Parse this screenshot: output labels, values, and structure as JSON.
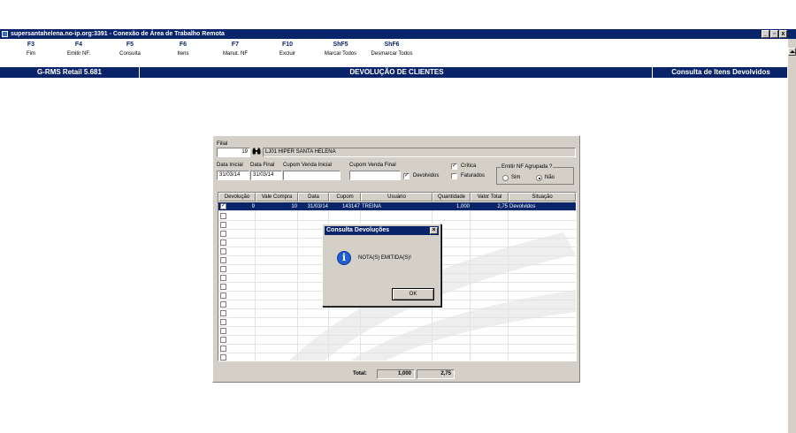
{
  "window": {
    "title": "supersantahelena.no-ip.org:3391 - Conexão de Área de Trabalho Remota",
    "min_glyph": "_",
    "max_glyph": "▫",
    "close_glyph": "x"
  },
  "function_keys": [
    {
      "key": "F3",
      "label": "Fim"
    },
    {
      "key": "F4",
      "label": "Emitir NF."
    },
    {
      "key": "F5",
      "label": "Consulta"
    },
    {
      "key": "F6",
      "label": "Itens"
    },
    {
      "key": "F7",
      "label": "Manut. NF"
    },
    {
      "key": "F10",
      "label": "Excluir"
    },
    {
      "key": "ShF5",
      "label": "Marcar Todos"
    },
    {
      "key": "ShF6",
      "label": "Desmarcar Todos"
    }
  ],
  "header": {
    "version": "G-RMS Retail 5.681",
    "screen_title": "DEVOLUÇÃO DE CLIENTES",
    "context": "Consulta de Itens Devolvidos"
  },
  "form": {
    "filial_label": "Filial",
    "filial_code": "19",
    "filial_name": "LJ01 HIPER SANTA HELENA",
    "data_inicial_label": "Data Inicial",
    "data_final_label": "Data Final",
    "cupom_inicial_label": "Cupom Venda Inicial",
    "cupom_final_label": "Cupom Venda Final",
    "data_inicial": "31/03/14",
    "data_final": "31/03/14",
    "critica_label": "Crítica",
    "devolvidos_label": "Devolvidos",
    "faturados_label": "Faturados",
    "agrupada_label": "Emitir NF Agrupada ?",
    "sim_label": "Sim",
    "nao_label": "Não"
  },
  "grid": {
    "columns": [
      "Devolução",
      "Vale Compra",
      "Data",
      "Cupom",
      "Usuário",
      "Quantidade",
      "Valor Total",
      "Situação"
    ],
    "rows": [
      {
        "devolucao": "9",
        "vale_compra": "10",
        "data": "31/03/14",
        "cupom": "143147",
        "usuario": "TREINA",
        "quantidade": "1,000",
        "valor_total": "2,75",
        "situacao": "Devolvidos",
        "checked": true
      }
    ],
    "empty_rows": 17
  },
  "totals": {
    "label": "Total:",
    "quantidade": "1,000",
    "valor": "2,75"
  },
  "dialog": {
    "title": "Consulta Devoluções",
    "message": "NOTA(S) EMITIDA(S)!",
    "ok_label": "OK"
  },
  "colors": {
    "titlebar": "#0a246a",
    "face": "#d4d0c8",
    "selection": "#0a246a"
  }
}
